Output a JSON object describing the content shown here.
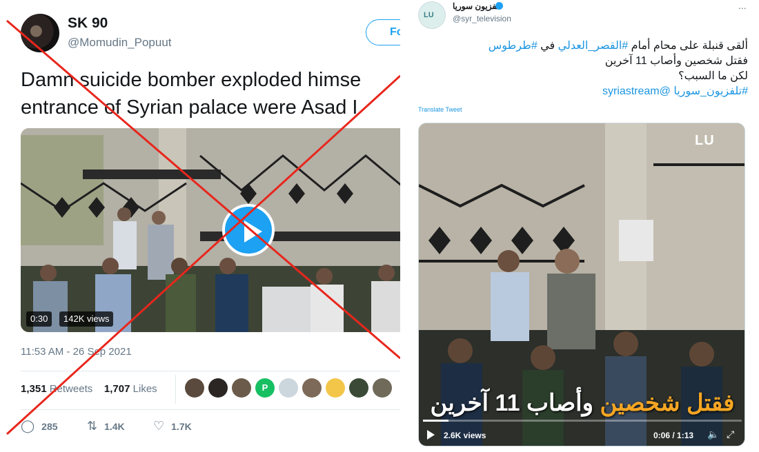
{
  "left_tweet": {
    "name": "SK 90",
    "handle": "@Momudin_Popuut",
    "follow_label": "Fo",
    "text_line1": "Damn suicide bomber exploded himse",
    "text_line2": "entrance of Syrian palace were Asad I",
    "video_duration": "0:30",
    "video_views": "142K views",
    "date": "11:53 AM - 26 Sep 2021",
    "retweets_count": "1,351",
    "retweets_label": "Retweets",
    "likes_count": "1,707",
    "likes_label": "Likes",
    "liker_p_initial": "P",
    "replies": "285",
    "retweet_action": "1.4K",
    "like_action": "1.7K"
  },
  "right_tweet": {
    "name": "تلفزيون سوريا",
    "handle": "@syr_television",
    "more": "...",
    "avatar_text": "LU",
    "text_line1_a": "ألقى قنبلة على محام أمام ",
    "text_line1_tag1": "#القصر_العدلي",
    "text_line1_b": " في ",
    "text_line1_tag2": "#طرطوس",
    "text_line2": "فقتل شخصين وأصاب 11 آخرين",
    "text_line3": "لكن ما السبب؟",
    "text_line4_tag": "#تلفزيون_سوريا",
    "text_line4_mention": "@syriastream",
    "translate_label": "Translate Tweet",
    "stream_logo": "LU",
    "caption_highlight": "فقتل شخصين",
    "caption_rest": " وأصاب 11 آخرين",
    "views": "2.6K views",
    "time": "0:06 / 1:13",
    "progress": 0.08
  },
  "colors": {
    "twitter_blue": "#1da1f2",
    "cross_red": "#e8261c",
    "caption_orange": "#f5a623"
  },
  "icons": {
    "reply": "reply-icon",
    "retweet": "retweet-icon",
    "like": "heart-icon",
    "play": "play-icon",
    "volume": "volume-icon",
    "fullscreen": "fullscreen-icon"
  }
}
